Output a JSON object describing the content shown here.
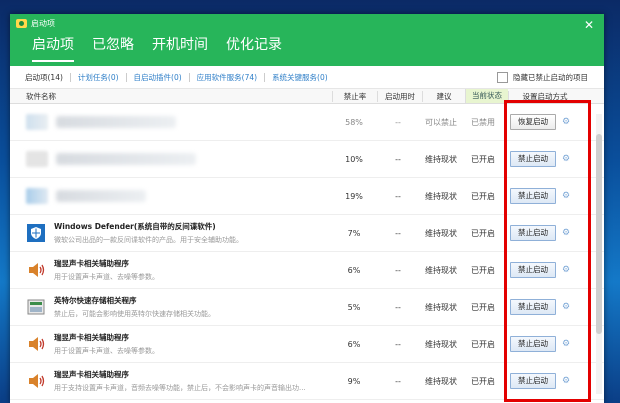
{
  "window": {
    "title": "启动项"
  },
  "main_tabs": [
    {
      "label": "启动项"
    },
    {
      "label": "已忽略"
    },
    {
      "label": "开机时间"
    },
    {
      "label": "优化记录"
    }
  ],
  "sub_tabs": [
    {
      "label": "启动项(14)"
    },
    {
      "label": "计划任务(0)"
    },
    {
      "label": "自启动插件(0)"
    },
    {
      "label": "应用软件服务(74)"
    },
    {
      "label": "系统关键服务(0)"
    }
  ],
  "hide_disabled_label": "隐藏已禁止启动的项目",
  "columns": {
    "name": "软件名称",
    "rate": "禁止率",
    "time": "启动用时",
    "suggest": "建议",
    "status": "当前状态",
    "method": "设置启动方式"
  },
  "rows": [
    {
      "name": "",
      "desc": "",
      "rate": "58%",
      "time": "--",
      "suggest": "可以禁止",
      "status": "已禁用",
      "action": "恢复启动"
    },
    {
      "name": "",
      "desc": "",
      "rate": "10%",
      "time": "--",
      "suggest": "维持现状",
      "status": "已开启",
      "action": "禁止启动"
    },
    {
      "name": "",
      "desc": "",
      "rate": "19%",
      "time": "--",
      "suggest": "维持现状",
      "status": "已开启",
      "action": "禁止启动"
    },
    {
      "name": "Windows Defender(系统自带的反间谍软件)",
      "desc": "微软公司出品的一款反间谍软件的产品。用于安全辅助功能。",
      "rate": "7%",
      "time": "--",
      "suggest": "维持现状",
      "status": "已开启",
      "action": "禁止启动"
    },
    {
      "name": "瑞昱声卡相关辅助程序",
      "desc": "用于设置声卡声道、去噪等参数。",
      "rate": "6%",
      "time": "--",
      "suggest": "维持现状",
      "status": "已开启",
      "action": "禁止启动"
    },
    {
      "name": "英特尔快速存储相关程序",
      "desc": "禁止后，可能会影响使用英特尔快速存储相关功能。",
      "rate": "5%",
      "time": "--",
      "suggest": "维持现状",
      "status": "已开启",
      "action": "禁止启动"
    },
    {
      "name": "瑞昱声卡相关辅助程序",
      "desc": "用于设置声卡声道、去噪等参数。",
      "rate": "6%",
      "time": "--",
      "suggest": "维持现状",
      "status": "已开启",
      "action": "禁止启动"
    },
    {
      "name": "瑞昱声卡相关辅助程序",
      "desc": "用于支持设置声卡声道，音频去噪等功能，禁止后，不会影响声卡的声音输出功...",
      "rate": "9%",
      "time": "--",
      "suggest": "维持现状",
      "status": "已开启",
      "action": "禁止启动"
    }
  ],
  "colors": {
    "header_green": "#27b55a",
    "highlight_red": "#e30000",
    "link_blue": "#2f7fc8"
  }
}
